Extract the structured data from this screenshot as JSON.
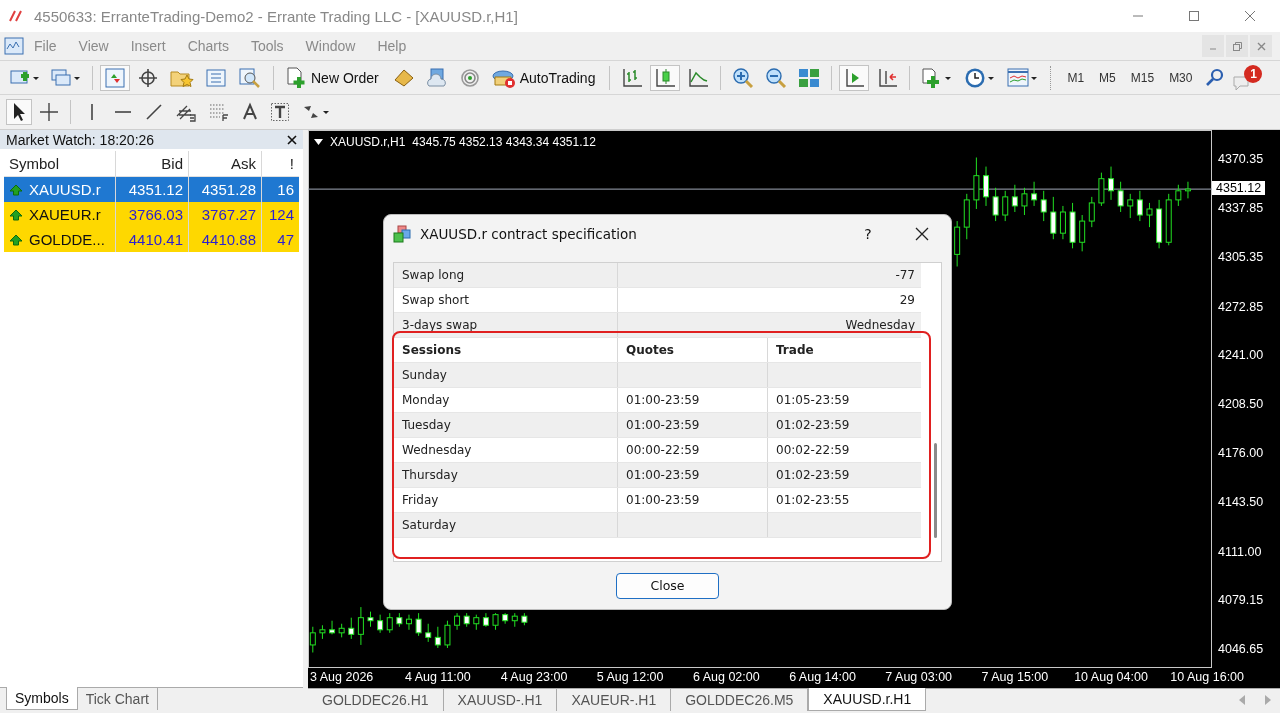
{
  "window": {
    "title": "4550633: ErranteTrading-Demo2 - Errante Trading LLC - [XAUUSD.r,H1]"
  },
  "menu": [
    "File",
    "View",
    "Insert",
    "Charts",
    "Tools",
    "Window",
    "Help"
  ],
  "toolbar": {
    "market_watch": true,
    "new_order": "New Order",
    "autotrading": "AutoTrading",
    "chart_types": [
      {
        "selected": false
      },
      {
        "selected": true
      },
      {
        "selected": false
      }
    ],
    "auto_scroll": true,
    "chart_shift": false,
    "timeframes": [
      "M1",
      "M5",
      "M15",
      "M30"
    ],
    "notification_count": "1"
  },
  "drawing_tools": {
    "cursor": true,
    "crosshair": false
  },
  "market_watch": {
    "title": "Market Watch: 18:20:26",
    "columns": [
      "Symbol",
      "Bid",
      "Ask",
      "!"
    ],
    "rows": [
      {
        "symbol": "XAUUSD.r",
        "bid": "4351.12",
        "ask": "4351.28",
        "spread": "16",
        "selected": true
      },
      {
        "symbol": "XAUEUR.r",
        "bid": "3766.03",
        "ask": "3767.27",
        "spread": "124",
        "selected": false
      },
      {
        "symbol": "GOLDDE...",
        "bid": "4410.41",
        "ask": "4410.88",
        "spread": "47",
        "selected": false
      }
    ],
    "tabs": [
      {
        "label": "Symbols",
        "selected": true
      },
      {
        "label": "Tick Chart",
        "selected": false
      }
    ]
  },
  "chart": {
    "symbol": "XAUUSD.r,H1",
    "ohlc": "4345.75 4352.13 4343.34 4351.12",
    "chart_data": {
      "type": "candlestick",
      "categories": [
        null,
        null,
        null,
        "3 Aug 2026",
        null,
        null,
        null,
        null,
        null,
        null,
        null,
        null,
        null,
        "4 Aug 11:00",
        null,
        null,
        null,
        null,
        null,
        null,
        null,
        null,
        null,
        "4 Aug 23:00",
        null,
        null,
        null,
        null,
        null,
        null,
        null,
        null,
        null,
        "5 Aug 12:00",
        null,
        null,
        null,
        null,
        null,
        null,
        null,
        null,
        null,
        "6 Aug 02:00",
        null,
        null,
        null,
        null,
        null,
        null,
        null,
        null,
        null,
        "6 Aug 14:00",
        null,
        null,
        null,
        null,
        null,
        null,
        null,
        null,
        null,
        "7 Aug 03:00",
        null,
        null,
        null,
        null,
        null,
        null,
        null,
        null,
        null,
        "7 Aug 15:00",
        null,
        null,
        null,
        null,
        null,
        null,
        null,
        null,
        null,
        "10 Aug 04:00",
        null,
        null,
        null,
        null,
        null,
        null,
        null,
        null,
        null,
        "10 Aug 16:00"
      ],
      "ohlc": [
        [
          4050,
          4062,
          4045,
          4058
        ],
        [
          4058,
          4063,
          4054,
          4060
        ],
        [
          4060,
          4066,
          4057,
          4058
        ],
        [
          4058,
          4064,
          4055,
          4061
        ],
        [
          4061,
          4068,
          4054,
          4057
        ],
        [
          4057,
          4075,
          4050,
          4068
        ],
        [
          4068,
          4072,
          4062,
          4066
        ],
        [
          4066,
          4070,
          4058,
          4060
        ],
        [
          4060,
          4071,
          4058,
          4068
        ],
        [
          4068,
          4071,
          4062,
          4064
        ],
        [
          4064,
          4070,
          4060,
          4067
        ],
        [
          4067,
          4071,
          4056,
          4058
        ],
        [
          4058,
          4064,
          4052,
          4055
        ],
        [
          4055,
          4062,
          4048,
          4050
        ],
        [
          4050,
          4066,
          4048,
          4063
        ],
        [
          4063,
          4071,
          4060,
          4069
        ],
        [
          4069,
          4071,
          4062,
          4064
        ],
        [
          4064,
          4070,
          4060,
          4068
        ],
        [
          4068,
          4071,
          4062,
          4063
        ],
        [
          4063,
          4071,
          4060,
          4070
        ],
        [
          4070,
          4071,
          4064,
          4066
        ],
        [
          4066,
          4071,
          4062,
          4069
        ],
        [
          4069,
          4071,
          4063,
          4065
        ],
        null,
        null,
        null,
        null,
        null,
        null,
        null,
        null,
        null,
        null,
        null,
        null,
        null,
        null,
        null,
        null,
        null,
        null,
        null,
        null,
        null,
        null,
        null,
        null,
        null,
        null,
        null,
        null,
        null,
        null,
        null,
        null,
        null,
        null,
        null,
        null,
        null,
        null,
        null,
        null,
        null,
        null,
        null,
        null,
        [
          4308,
          4330,
          4300,
          4326
        ],
        [
          4326,
          4348,
          4318,
          4344
        ],
        [
          4344,
          4372,
          4338,
          4360
        ],
        [
          4360,
          4366,
          4340,
          4346
        ],
        [
          4346,
          4352,
          4330,
          4334
        ],
        [
          4334,
          4350,
          4330,
          4346
        ],
        [
          4346,
          4354,
          4336,
          4340
        ],
        [
          4340,
          4352,
          4334,
          4348
        ],
        [
          4348,
          4356,
          4340,
          4344
        ],
        [
          4344,
          4350,
          4330,
          4336
        ],
        [
          4336,
          4346,
          4318,
          4322
        ],
        [
          4322,
          4340,
          4318,
          4336
        ],
        [
          4336,
          4342,
          4312,
          4316
        ],
        [
          4316,
          4334,
          4310,
          4330
        ],
        [
          4330,
          4346,
          4326,
          4342
        ],
        [
          4342,
          4362,
          4340,
          4358
        ],
        [
          4358,
          4366,
          4344,
          4350
        ],
        [
          4350,
          4356,
          4336,
          4340
        ],
        [
          4340,
          4348,
          4332,
          4344
        ],
        [
          4344,
          4350,
          4330,
          4334
        ],
        [
          4334,
          4342,
          4326,
          4338
        ],
        [
          4338,
          4344,
          4312,
          4316
        ],
        [
          4316,
          4348,
          4314,
          4344
        ],
        [
          4344,
          4354,
          4340,
          4350
        ],
        [
          4350,
          4356,
          4345,
          4351.12
        ],
        null,
        null
      ],
      "ylim": [
        4034.76,
        4390.17
      ],
      "ref_lines": [
        {
          "axis": "y",
          "value": 4351.12,
          "label": "4351.12"
        }
      ],
      "yticks": [
        {
          "value": 4370.35,
          "label": "4370.35"
        },
        {
          "value": 4337.85,
          "label": "4337.85"
        },
        {
          "value": 4305.35,
          "label": "4305.35"
        },
        {
          "value": 4272.85,
          "label": "4272.85"
        },
        {
          "value": 4241,
          "label": "4241.00"
        },
        {
          "value": 4208.5,
          "label": "4208.50"
        },
        {
          "value": 4176,
          "label": "4176.00"
        },
        {
          "value": 4143.5,
          "label": "4143.50"
        },
        {
          "value": 4111,
          "label": "4111.00"
        },
        {
          "value": 4079.15,
          "label": "4079.15"
        },
        {
          "value": 4046.65,
          "label": "4046.65"
        }
      ]
    }
  },
  "dialog": {
    "title": "XAUUSD.r contract specification",
    "help": "?",
    "spec_rows": [
      {
        "label": "Swap long",
        "value": "-77"
      },
      {
        "label": "Swap short",
        "value": "29"
      },
      {
        "label": "3-days swap",
        "value": "Wednesday"
      }
    ],
    "session_columns": [
      "Sessions",
      "Quotes",
      "Trade"
    ],
    "sessions": [
      {
        "day": "Sunday"
      },
      {
        "day": "Monday",
        "quotes": "01:00-23:59",
        "trade": "01:05-23:59"
      },
      {
        "day": "Tuesday",
        "quotes": "01:00-23:59",
        "trade": "01:02-23:59"
      },
      {
        "day": "Wednesday",
        "quotes": "00:00-22:59",
        "trade": "00:02-22:59"
      },
      {
        "day": "Thursday",
        "quotes": "01:00-23:59",
        "trade": "01:02-23:59"
      },
      {
        "day": "Friday",
        "quotes": "01:00-23:59",
        "trade": "01:02-23:55"
      },
      {
        "day": "Saturday"
      }
    ],
    "sessions_highlighted": true,
    "close_button": "Close"
  },
  "chart_tabs": [
    {
      "label": "GOLDDEC26.H1",
      "selected": false
    },
    {
      "label": "XAUUSD-.H1",
      "selected": false
    },
    {
      "label": "XAUEUR-.H1",
      "selected": false
    },
    {
      "label": "GOLDDEC26.M5",
      "selected": false
    },
    {
      "label": "XAUUSD.r.H1",
      "selected": true
    }
  ]
}
